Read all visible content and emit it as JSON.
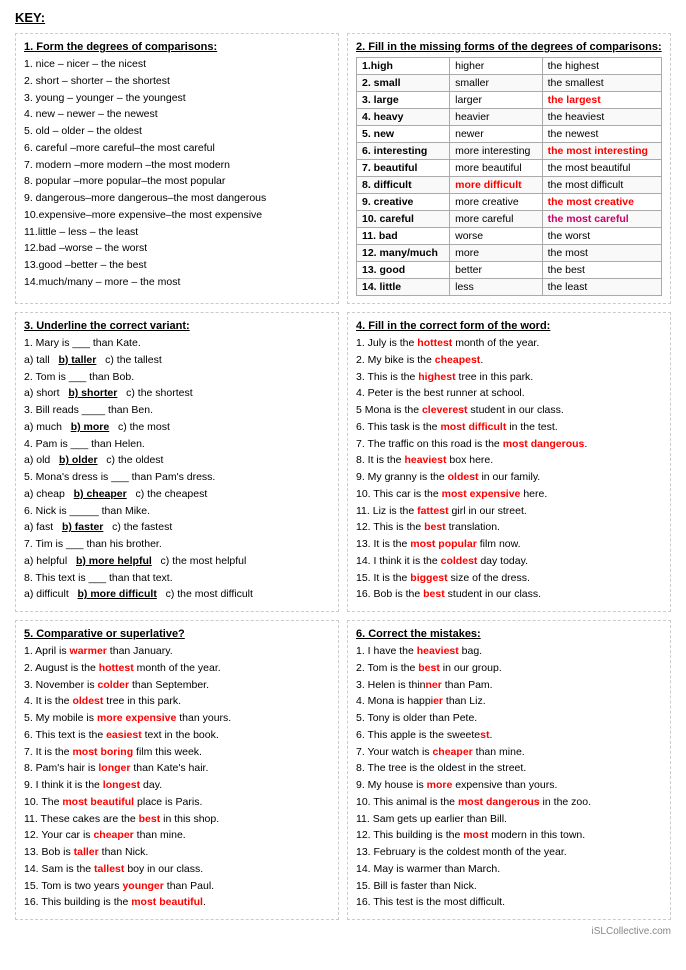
{
  "key": "KEY:",
  "watermark": "iSLCollective.com",
  "section1": {
    "title": "1. Form the degrees of comparisons:",
    "items": [
      "1. nice – nicer – the nicest",
      "2. short – shorter – the shortest",
      "3. young – younger – the youngest",
      "4. new – newer – the newest",
      "5. old – older – the oldest",
      "6. careful –more careful–the most careful",
      "7. modern –more modern –the most modern",
      "8. popular –more popular–the most popular",
      "9. dangerous–more dangerous–the most dangerous",
      "10.expensive–more expensive–the most expensive",
      "11.little – less – the least",
      "12.bad –worse – the worst",
      "13.good –better – the best",
      "14.much/many – more – the most"
    ]
  },
  "section2": {
    "title": "2. Fill in the missing forms of the degrees of comparisons:",
    "rows": [
      {
        "base": "1.high",
        "comp": "higher",
        "sup": "the highest",
        "supColor": ""
      },
      {
        "base": "2. small",
        "comp": "smaller",
        "sup": "the smallest",
        "supColor": ""
      },
      {
        "base": "3. large",
        "comp": "larger",
        "sup": "the largest",
        "supColor": "red"
      },
      {
        "base": "4. heavy",
        "comp": "heavier",
        "sup": "the heaviest",
        "supColor": ""
      },
      {
        "base": "5. new",
        "comp": "newer",
        "sup": "the newest",
        "supColor": ""
      },
      {
        "base": "6. interesting",
        "comp": "more interesting",
        "sup": "the most interesting",
        "supColor": "red"
      },
      {
        "base": "7. beautiful",
        "comp": "more beautiful",
        "sup": "the most beautiful",
        "supColor": ""
      },
      {
        "base": "8. difficult",
        "comp": "more difficult",
        "sup": "the most difficult",
        "supColor": ""
      },
      {
        "base": "9. creative",
        "comp": "more creative",
        "sup": "the most creative",
        "supColor": "red"
      },
      {
        "base": "10. careful",
        "comp": "more careful",
        "sup": "the most careful",
        "supColor": "pink"
      },
      {
        "base": "11. bad",
        "comp": "worse",
        "sup": "the worst",
        "supColor": ""
      },
      {
        "base": "12. many/much",
        "comp": "more",
        "sup": "the most",
        "supColor": ""
      },
      {
        "base": "13. good",
        "comp": "better",
        "sup": "the best",
        "supColor": ""
      },
      {
        "base": "14. little",
        "comp": "less",
        "sup": "the least",
        "supColor": ""
      }
    ]
  },
  "section3": {
    "title": "3. Underline the correct variant:",
    "items": [
      "1. Mary is ___ than Kate.",
      "a) tall   b) taller   c) the tallest",
      "2. Tom is ___ than Bob.",
      "a) short   b) shorter   c) the shortest",
      "3. Bill reads ____ than Ben.",
      "a) much   b) more   c) the most",
      "4. Pam is ___ than Helen.",
      "a) old   b) older   c) the oldest",
      "5. Mona's dress is ___ than Pam's dress.",
      "a) cheap   b) cheaper   c) the cheapest",
      "6. Nick is _____ than Mike.",
      "a) fast   b) faster   c) the fastest",
      "7. Tim is ___ than his brother.",
      "a) helpful   b) more helpful   c) the most helpful",
      "8. This text is ___ than that text.",
      "a) difficult   b) more difficult   c) the most difficult"
    ]
  },
  "section4": {
    "title": "4. Fill in the correct form of the word:",
    "items": [
      "1. July is the hottest month of the year.",
      "2. My bike is the cheapest.",
      "3. This is the highest tree in this park.",
      "4. Peter is the best runner at school.",
      "5 Mona is the cleverest student in our class.",
      "6. This task is the most difficult in the test.",
      "7. The traffic on this road is the most dangerous.",
      "8. It is the heaviest box here.",
      "9. My granny is the oldest in our family.",
      "10. This car is the most expensive here.",
      "11. Liz is the fattest girl in our street.",
      "12. This is the best translation.",
      "13. It is the most popular film now.",
      "14. I think it is the coldest day today.",
      "15. It is the biggest size of the dress.",
      "16. Bob is the best student in our class."
    ]
  },
  "section5": {
    "title": "5. Comparative or superlative?",
    "items": [
      "1. April is warmer than January.",
      "2. August is the hottest month of the year.",
      "3. November is colder than September.",
      "4. It is the oldest tree in this park.",
      "5. My mobile is more expensive than yours.",
      "6. This text is the easiest text in the book.",
      "7. It is the most boring film this week.",
      "8. Pam's hair is longer than Kate's hair.",
      "9. I think it is the longest day.",
      "10. The most beautiful place is Paris.",
      "11. These cakes are the best in this shop.",
      "12. Your car is cheaper than mine.",
      "13. Bob is taller than Nick.",
      "14. Sam is the tallest boy in our class.",
      "15. Tom is two years younger than Paul.",
      "16. This building is the most beautiful."
    ]
  },
  "section6": {
    "title": "6. Correct the mistakes:",
    "items": [
      "1. I have the heaviest bag.",
      "2. Tom is the best in our group.",
      "3. Helen is thinner than Pam.",
      "4. Mona is happier than Liz.",
      "5. Tony is older than Pete.",
      "6. This apple is the sweetest.",
      "7. Your watch is cheaper than mine.",
      "8. The tree is the oldest in the street.",
      "9. My house is more expensive than yours.",
      "10. This animal is the most dangerous in the zoo.",
      "11. Sam gets up earlier than Bill.",
      "12. This building is the most modern in this town.",
      "13. February is the coldest month of the year.",
      "14. May is warmer than March.",
      "15. Bill is faster than Nick.",
      "16. This test is the most difficult."
    ]
  }
}
